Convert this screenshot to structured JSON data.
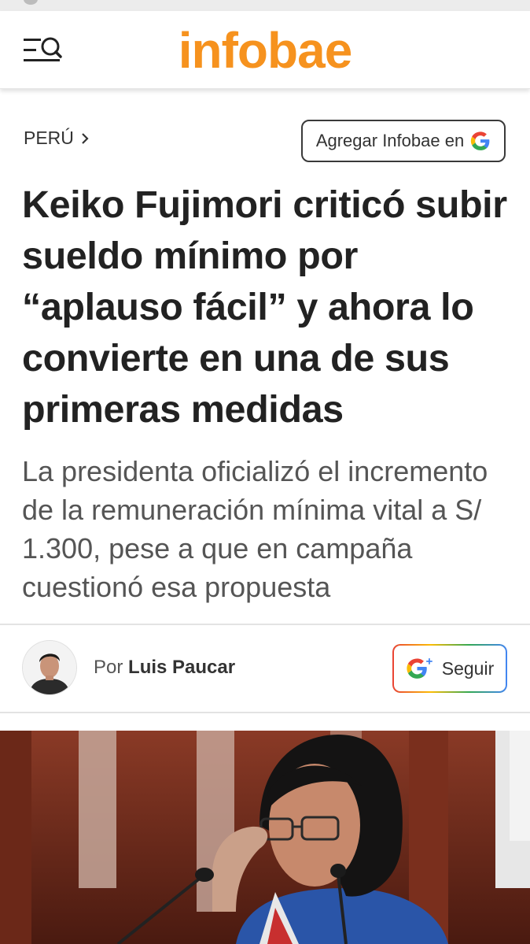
{
  "site": {
    "logo": "infobae",
    "brand_color": "#f6921e"
  },
  "icons": {
    "menu": "menu-search-icon",
    "google": "google-g-icon",
    "chevron": "chevron-right-icon",
    "google_plus": "google-plus-icon"
  },
  "breadcrumb": {
    "section": "PERÚ"
  },
  "google_pref_button": {
    "label": "Agregar Infobae en"
  },
  "article": {
    "headline": "Keiko Fujimori criticó subir sueldo mínimo por “aplauso fácil” y ahora lo convierte en una de sus primeras medidas",
    "subheadline": "La presidenta oficializó el incremento de la remuneración mínima vital a S/ 1.300, pese a que en campaña cuestionó esa propuesta"
  },
  "byline": {
    "prefix": "Por",
    "author": "Luis Paucar"
  },
  "follow_button": {
    "label": "Seguir"
  }
}
